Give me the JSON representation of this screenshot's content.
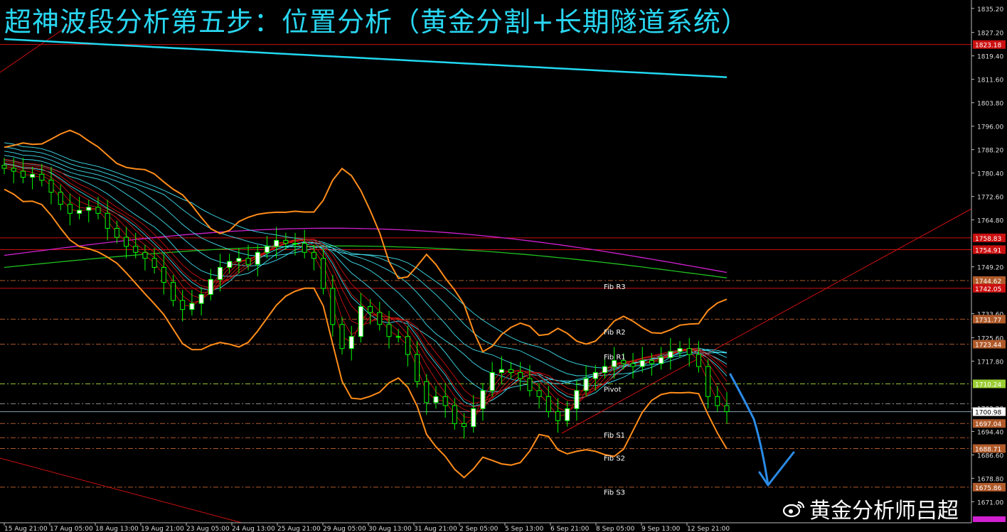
{
  "title": "超神波段分析第五步：位置分析（黄金分割+长期隧道系统）",
  "watermark": "黄金分析师吕超",
  "colors": {
    "background": "#000000",
    "candle_body": "#ffffff",
    "candle_wick": "#00ff00",
    "bollinger": "#ff8c1a",
    "long_ma": "#21d8f0",
    "magenta_ma": "#d020d0",
    "green_ma": "#20c020",
    "fast_ribbon": "#cc1010",
    "slow_ribbon": "#40e0f0",
    "level_red": "#cc1010",
    "arrow": "#2b8be6"
  },
  "chart_data": {
    "type": "candlestick",
    "ylim": [
      1664.0,
      1838.0
    ],
    "y_ticks": [
      "1835.20",
      "1827.20",
      "1819.40",
      "1811.60",
      "1803.80",
      "1796.00",
      "1788.20",
      "1780.40",
      "1772.60",
      "1764.80",
      "1749.20",
      "1733.60",
      "1725.60",
      "1717.80",
      "1702.20",
      "1694.40",
      "1686.60",
      "1678.80",
      "1671.00"
    ],
    "x_ticks": [
      "15 Aug 21:00",
      "17 Aug 05:00",
      "18 Aug 13:00",
      "19 Aug 21:00",
      "23 Aug 05:00",
      "24 Aug 13:00",
      "25 Aug 21:00",
      "29 Aug 05:00",
      "30 Aug 13:00",
      "31 Aug 21:00",
      "2 Sep 05:00",
      "5 Sep 13:00",
      "6 Sep 21:00",
      "8 Sep 05:00",
      "9 Sep 13:00",
      "12 Sep 21:00"
    ],
    "price_tags": [
      {
        "value": "1823.18",
        "price": 1823.18,
        "bg": "#cc1010"
      },
      {
        "value": "1758.83",
        "price": 1758.83,
        "bg": "#cc1010"
      },
      {
        "value": "1754.91",
        "price": 1754.91,
        "bg": "#cc1010"
      },
      {
        "value": "1744.62",
        "price": 1744.62,
        "bg": "#b05a2a"
      },
      {
        "value": "1742.05",
        "price": 1742.05,
        "bg": "#cc1010"
      },
      {
        "value": "1731.77",
        "price": 1731.77,
        "bg": "#b05a2a"
      },
      {
        "value": "1723.44",
        "price": 1723.44,
        "bg": "#b05a2a"
      },
      {
        "value": "1710.24",
        "price": 1710.24,
        "bg": "#9acd32"
      },
      {
        "value": "1700.98",
        "price": 1700.98,
        "bg": "#ffffff"
      },
      {
        "value": "1697.04",
        "price": 1697.04,
        "bg": "#b05a2a"
      },
      {
        "value": "1688.71",
        "price": 1688.71,
        "bg": "#b05a2a"
      },
      {
        "value": "1675.86",
        "price": 1675.86,
        "bg": "#b05a2a"
      }
    ],
    "horizontal_levels": [
      {
        "price": 1823.18,
        "style": "solid",
        "color": "#cc1010"
      },
      {
        "price": 1758.83,
        "style": "solid",
        "color": "#cc1010"
      },
      {
        "price": 1754.91,
        "style": "solid",
        "color": "#cc1010"
      },
      {
        "price": 1742.05,
        "style": "solid",
        "color": "#cc1010"
      },
      {
        "price": 1744.62,
        "style": "dashdot",
        "color": "#b05a2a"
      },
      {
        "price": 1731.77,
        "style": "dashdot",
        "color": "#b05a2a"
      },
      {
        "price": 1723.44,
        "style": "dashdot",
        "color": "#b05a2a"
      },
      {
        "price": 1710.24,
        "style": "dashdot",
        "color": "#9acd32"
      },
      {
        "price": 1703.6,
        "style": "dashdot",
        "color": "#888888"
      },
      {
        "price": 1700.98,
        "style": "solid",
        "color": "#8aa0b0"
      },
      {
        "price": 1697.04,
        "style": "dashdot",
        "color": "#b05a2a"
      },
      {
        "price": 1692.3,
        "style": "dashdot",
        "color": "#b05a2a"
      },
      {
        "price": 1688.71,
        "style": "dashdot",
        "color": "#b05a2a"
      },
      {
        "price": 1675.86,
        "style": "dashdot",
        "color": "#b05a2a"
      }
    ],
    "fib_labels": [
      {
        "text": "Fib R3",
        "price": 1742.7
      },
      {
        "text": "Fib R2",
        "price": 1727.6
      },
      {
        "text": "Fib R1",
        "price": 1719.3
      },
      {
        "text": "Pivot",
        "price": 1708.6
      },
      {
        "text": "Fib S1",
        "price": 1693.3
      },
      {
        "text": "Fib S2",
        "price": 1685.6
      },
      {
        "text": "Fib S3",
        "price": 1674.3
      }
    ],
    "closes": [
      1782,
      1781,
      1779,
      1780,
      1778,
      1774,
      1770,
      1767,
      1768,
      1769,
      1767,
      1762,
      1759,
      1756,
      1754,
      1752,
      1749,
      1744,
      1738,
      1735,
      1737,
      1740,
      1745,
      1749,
      1751,
      1752,
      1750,
      1754,
      1756,
      1758,
      1757,
      1757,
      1754,
      1752,
      1742,
      1730,
      1722,
      1726,
      1736,
      1734,
      1730,
      1726,
      1726,
      1720,
      1711,
      1704,
      1706,
      1703,
      1697,
      1696,
      1702,
      1708,
      1714,
      1715,
      1714,
      1712,
      1708,
      1706,
      1701,
      1698,
      1702,
      1708,
      1712,
      1714,
      1716,
      1718,
      1717,
      1716,
      1718,
      1717,
      1719,
      1721,
      1722,
      1720,
      1716,
      1706,
      1703,
      1701
    ]
  }
}
